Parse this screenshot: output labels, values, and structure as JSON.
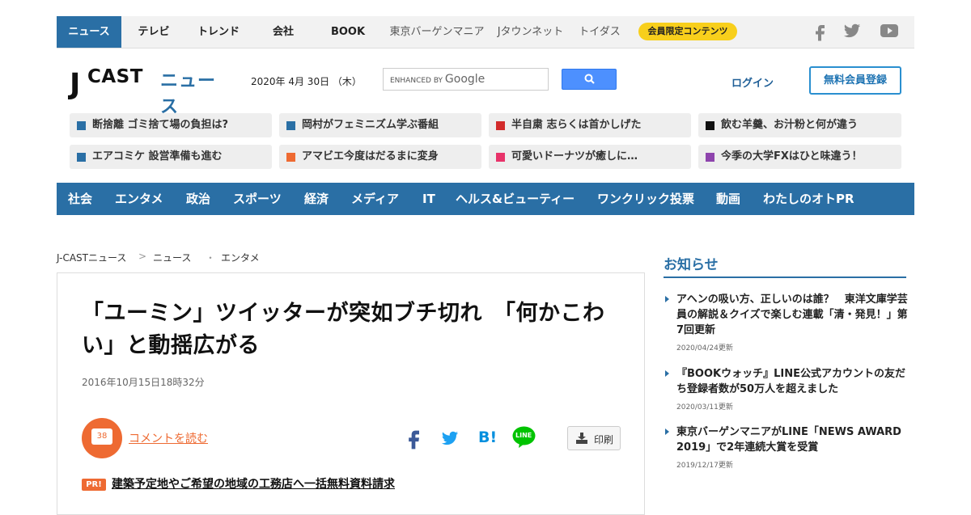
{
  "top_nav": {
    "items": [
      "ニュース",
      "テレビ",
      "トレンド",
      "会社",
      "BOOK",
      "東京バーゲンマニア",
      "Jタウンネット",
      "トイダス"
    ],
    "member_pill": "会員限定コンテンツ",
    "social": [
      "facebook-icon",
      "twitter-icon",
      "youtube-icon"
    ]
  },
  "header": {
    "logo_j": "J",
    "logo_cast": "CAST",
    "logo_news": "ニュース",
    "date": "2020年 4月 30日 （木）",
    "search_prefix": "ENHANCED BY",
    "search_google": "Google",
    "login": "ログイン",
    "register": "無料会員登録"
  },
  "topics": [
    {
      "label": "断捨離 ゴミ捨て場の負担は?",
      "color": "#2a6fa5"
    },
    {
      "label": "岡村がフェミニズム学ぶ番組",
      "color": "#2a6fa5"
    },
    {
      "label": "半自粛 志らくは首かしげた",
      "color": "#d22b2b"
    },
    {
      "label": "飲む羊羹、お汁粉と何が違う",
      "color": "#111111"
    },
    {
      "label": "エアコミケ 設営準備も進む",
      "color": "#2a6fa5"
    },
    {
      "label": "アマビエ今度はだるまに変身",
      "color": "#ee6a32"
    },
    {
      "label": "可愛いドーナツが癒しに…",
      "color": "#e8336a"
    },
    {
      "label": "今季の大学FXはひと味違う！",
      "color": "#8e44ad"
    }
  ],
  "categories": [
    "社会",
    "エンタメ",
    "政治",
    "スポーツ",
    "経済",
    "メディア",
    "IT",
    "ヘルス&ビューティー",
    "ワンクリック投票",
    "動画",
    "わたしのオトPR"
  ],
  "breadcrumb": [
    "J-CASTニュース",
    "ニュース",
    "エンタメ"
  ],
  "breadcrumb_seps": [
    ">",
    "・"
  ],
  "article": {
    "headline": "「ユーミン」ツイッターが突如ブチ切れ　「何かこわい」と動揺広がる",
    "date": "2016年10月15日18時32分",
    "comment_count": "38",
    "comment_link": "コメントを読む",
    "share": [
      "facebook-icon",
      "twitter-icon",
      "hatena-bookmark-icon",
      "line-icon"
    ],
    "line_label": "LINE",
    "hatena_label": "B!",
    "print": "印刷",
    "pr_badge": "PR!",
    "pr_link": "建築予定地やご希望の地域の工務店へ一括無料資料請求"
  },
  "sidebar": {
    "title": "お知らせ",
    "items": [
      {
        "title": "アヘンの吸い方、正しいのは誰？　東洋文庫学芸員の解説＆クイズで楽しむ連載「清・発見！」第7回更新",
        "date": "2020/04/24更新"
      },
      {
        "title": "『BOOKウォッチ』LINE公式アカウントの友だち登録者数が50万人を超えました",
        "date": "2020/03/11更新"
      },
      {
        "title": "東京バーゲンマニアがLINE「NEWS AWARD 2019」で2年連続大賞を受賞",
        "date": "2019/12/17更新"
      }
    ]
  }
}
